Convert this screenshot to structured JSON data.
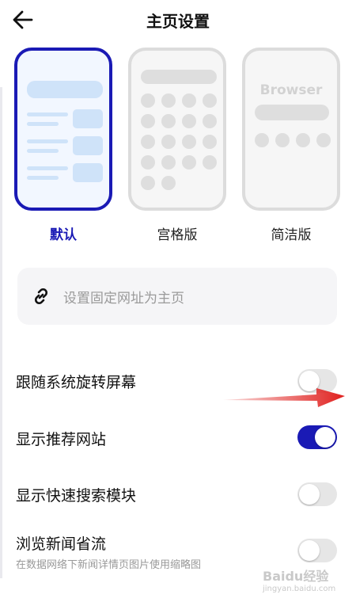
{
  "header": {
    "title": "主页设置"
  },
  "themes": [
    {
      "label": "默认",
      "selected": true
    },
    {
      "label": "宫格版",
      "selected": false
    },
    {
      "label": "简洁版",
      "selected": false,
      "preview_word": "Browser"
    }
  ],
  "url_box": {
    "placeholder": "设置固定网址为主页"
  },
  "settings": [
    {
      "label": "跟随系统旋转屏幕",
      "on": false
    },
    {
      "label": "显示推荐网站",
      "on": true
    },
    {
      "label": "显示快速搜索模块",
      "on": false
    },
    {
      "label": "浏览新闻省流",
      "sub": "在数据网络下新闻详情页图片使用缩略图",
      "on": false
    }
  ],
  "colors": {
    "accent": "#1a1ab5",
    "toggle_off": "#e6e6e6",
    "annotation_arrow": "#e0201e"
  },
  "icons": {
    "back": "arrow-left-icon",
    "link": "link-icon"
  },
  "watermark": {
    "main": "Baidu经验",
    "sub": "jingyan.baidu.com"
  }
}
